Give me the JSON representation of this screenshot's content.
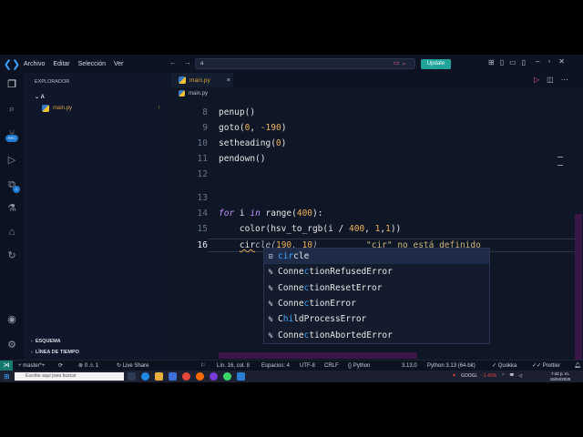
{
  "titlebar": {
    "menu": [
      "Archivo",
      "Editar",
      "Selección",
      "Ver"
    ],
    "search_value": "a",
    "update_label": "Update",
    "nav_back": "←",
    "nav_forward": "→"
  },
  "sidebar": {
    "title": "EXPLORADOR",
    "folder": "A",
    "file": "main.py",
    "file_badge": "!",
    "outline": "ESQUEMA",
    "timeline": "LÍNEA DE TIEMPO"
  },
  "activity_badges": {
    "accounts": "REC",
    "extensions": "1"
  },
  "tab": {
    "label": "main.py",
    "close": "×"
  },
  "breadcrumb": {
    "file": "main.py"
  },
  "editor": {
    "line_numbers": [
      "8",
      "9",
      "10",
      "11",
      "12",
      "13",
      "14",
      "15",
      "16"
    ],
    "lines": {
      "l8": "penup()",
      "l9_fn": "goto(",
      "l9_a": "0",
      "l9_b": ", ",
      "l9_c": "-190",
      "l9_d": ")",
      "l10_fn": "setheading(",
      "l10_a": "0",
      "l10_d": ")",
      "l11": "pendown()",
      "l14_for": "for",
      "l14_i": " i ",
      "l14_in": "in",
      "l14_range": " range(",
      "l14_num": "400",
      "l14_end": "):",
      "l15_a": "    color(hsv_to_rgb(i / ",
      "l15_num": "400",
      "l15_b": ", ",
      "l15_c": "1",
      "l15_d": ",",
      "l15_e": "1",
      "l15_f": "))",
      "l16_indent": "    ",
      "l16_typed": "cir",
      "l16_ghost": "cle",
      "l16_paren": "(",
      "l16_a": "190",
      "l16_b": ", ",
      "l16_c": "10",
      "l16_d": ")"
    },
    "diagnostic": "\"cir\" no está definido"
  },
  "suggestions": [
    {
      "pre": "",
      "match": "cir",
      "post": "cle",
      "icon": "⊡"
    },
    {
      "pre": "Conne",
      "match": "c",
      "post": "tionRefusedError",
      "icon": "%"
    },
    {
      "pre": "Conne",
      "match": "c",
      "post": "tionResetError",
      "icon": "%"
    },
    {
      "pre": "Conne",
      "match": "c",
      "post": "tionError",
      "icon": "%"
    },
    {
      "pre": "C",
      "match": "hi",
      "post": "ldProcessError",
      "icon": "%"
    },
    {
      "pre": "Conne",
      "match": "c",
      "post": "tionAbortedError",
      "icon": "%"
    }
  ],
  "statusbar": {
    "branch": "master*+",
    "sync": "⟳",
    "errors": "0",
    "warnings": "1",
    "live_share": "Live Share",
    "position": "Lín. 16, col. 8",
    "spaces": "Espacios: 4",
    "encoding": "UTF-8",
    "eol": "CRLF",
    "language": "Python",
    "py_version": "3.13.0",
    "interpreter": "Python 3.13 (64-bit)",
    "quokka": "Quokka",
    "prettier": "Prettier"
  },
  "taskbar": {
    "search_placeholder": "Escribe aquí para buscar",
    "ticker": "GOOGL",
    "ticker_change": "-1.40%",
    "time": "7:42 p. m.",
    "date": "15/04/2025"
  },
  "colors": {
    "accent": "#1fa39a",
    "string": "#c9b47a",
    "keyword": "#c691ff",
    "number": "#f0b35a",
    "match": "#3ea6ff"
  }
}
